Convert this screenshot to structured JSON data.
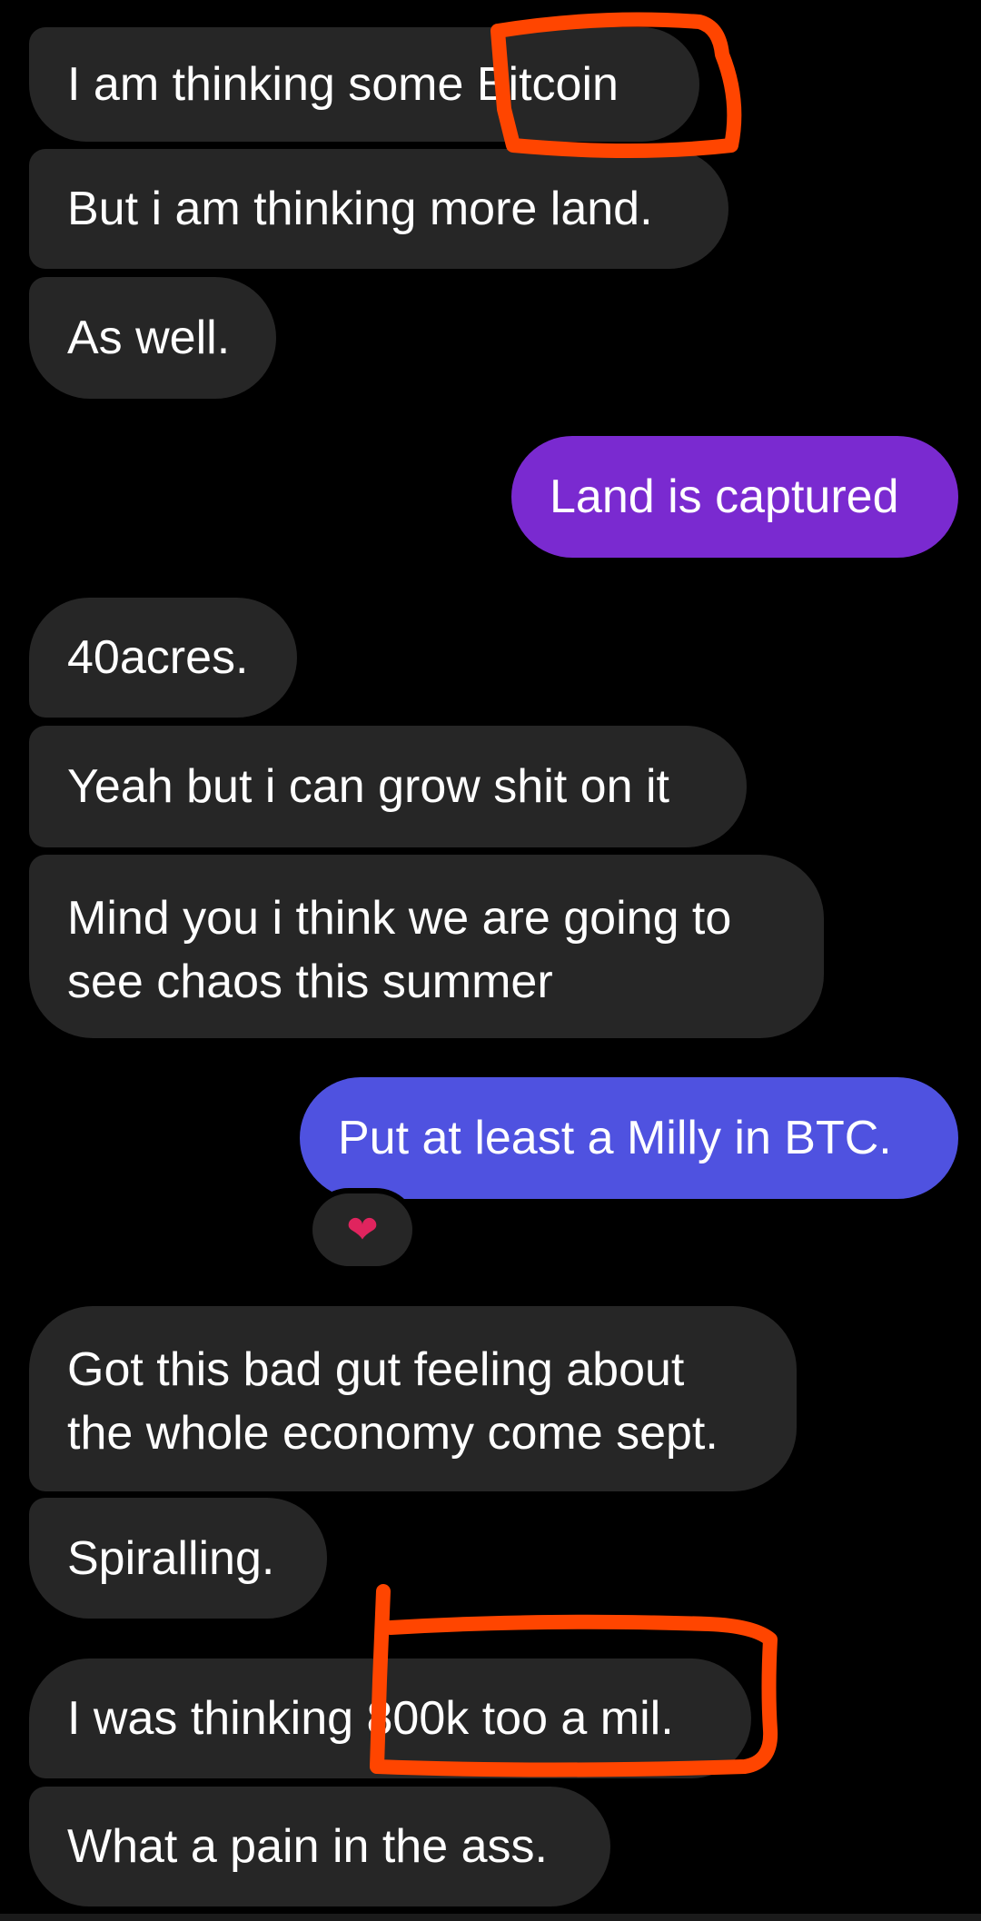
{
  "messages": [
    {
      "id": "m1",
      "direction": "incoming",
      "text": "I am thinking some Bitcoin"
    },
    {
      "id": "m2",
      "direction": "incoming",
      "text": "But i am thinking more land."
    },
    {
      "id": "m3",
      "direction": "incoming",
      "text": "As well."
    },
    {
      "id": "m4",
      "direction": "outgoing",
      "text": "Land is captured"
    },
    {
      "id": "m5",
      "direction": "incoming",
      "text": "40acres."
    },
    {
      "id": "m6",
      "direction": "incoming",
      "text": "Yeah but i can grow shit on it"
    },
    {
      "id": "m7",
      "direction": "incoming",
      "line1": "Mind you i think we are going to",
      "line2": "see chaos this summer"
    },
    {
      "id": "m8",
      "direction": "outgoing",
      "text": "Put at least a Milly in BTC."
    },
    {
      "id": "m9",
      "direction": "incoming",
      "line1": "Got this bad gut feeling about",
      "line2": "the whole economy come sept."
    },
    {
      "id": "m10",
      "direction": "incoming",
      "text": "Spiralling."
    },
    {
      "id": "m11",
      "direction": "incoming",
      "text": "I was thinking 800k too a mil."
    },
    {
      "id": "m12",
      "direction": "incoming",
      "text": "What a pain in the ass."
    }
  ],
  "reaction": {
    "icon": "heart-icon",
    "glyph": "❤"
  },
  "colors": {
    "background": "#000000",
    "incoming_bubble": "#262626",
    "outgoing_bubble_1": "#7a2ad0",
    "outgoing_bubble_2": "#4f52e0",
    "annotation": "#ff4500"
  }
}
